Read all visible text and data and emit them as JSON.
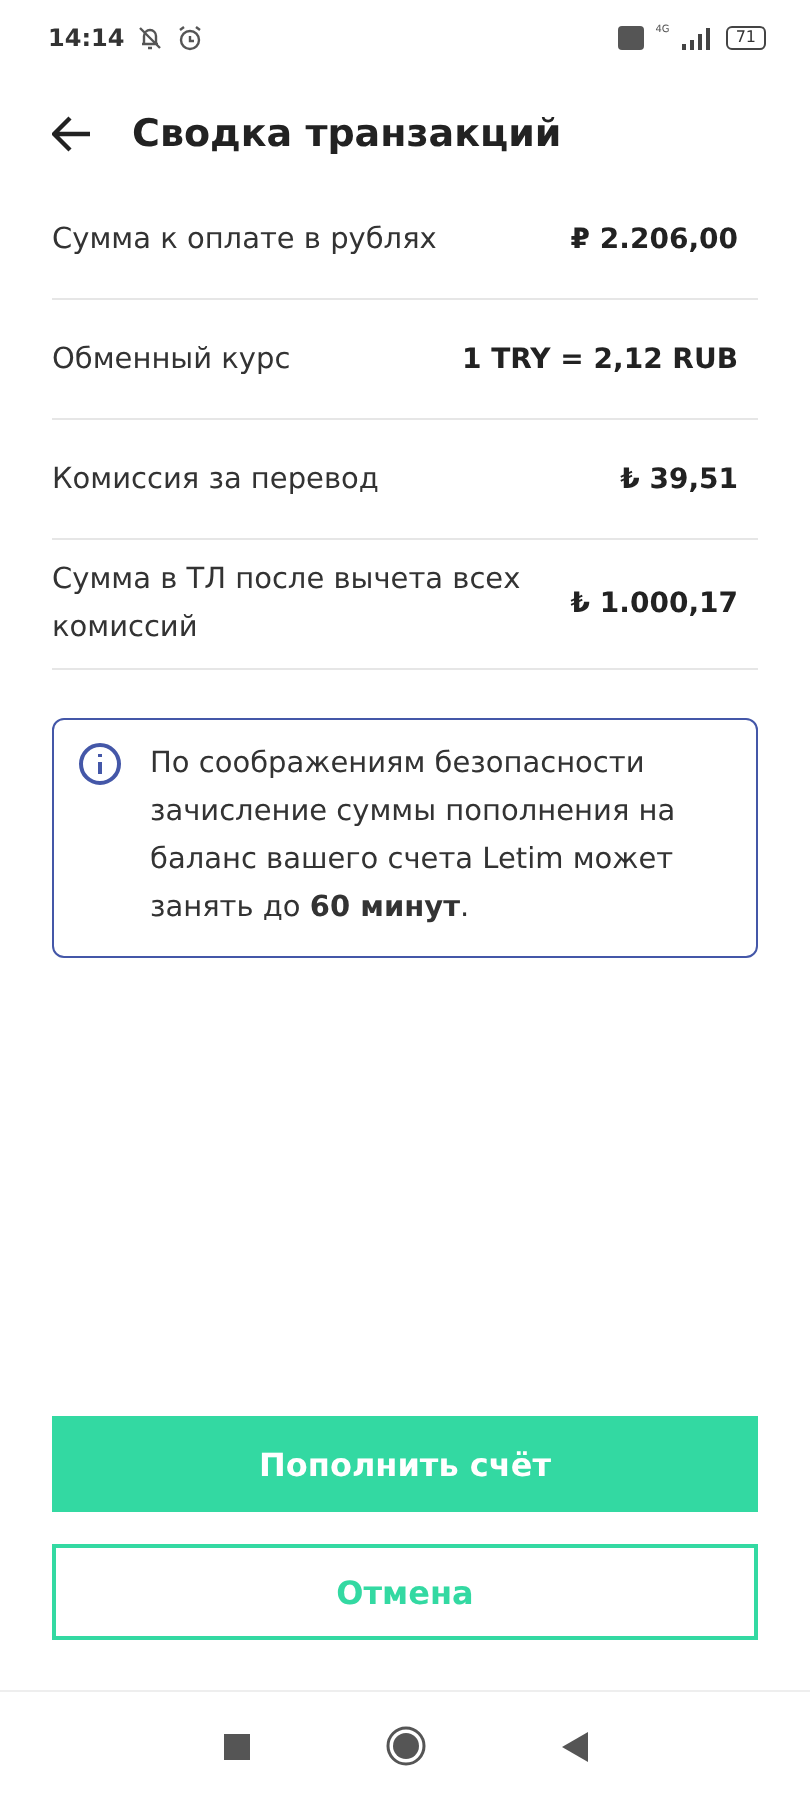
{
  "status_bar": {
    "time": "14:14",
    "network": "4G",
    "battery": "71"
  },
  "header": {
    "title": "Сводка транзакций"
  },
  "rows": [
    {
      "label": "Сумма к оплате в рублях",
      "value": "₽ 2.206,00"
    },
    {
      "label": "Обменный курс",
      "value": "1 TRY = 2,12 RUB"
    },
    {
      "label": "Комиссия за перевод",
      "value": "₺ 39,51"
    },
    {
      "label": "Сумма в ТЛ после вычета всех комиссий",
      "value": "₺ 1.000,17"
    }
  ],
  "notice": {
    "text": "По соображениям безопасности зачисление суммы пополнения на баланс вашего счета Letim может занять до **60 минут**."
  },
  "buttons": [
    {
      "label": "Пополнить счёт",
      "kind": "primary"
    },
    {
      "label": "Отмена",
      "kind": "secondary"
    }
  ]
}
